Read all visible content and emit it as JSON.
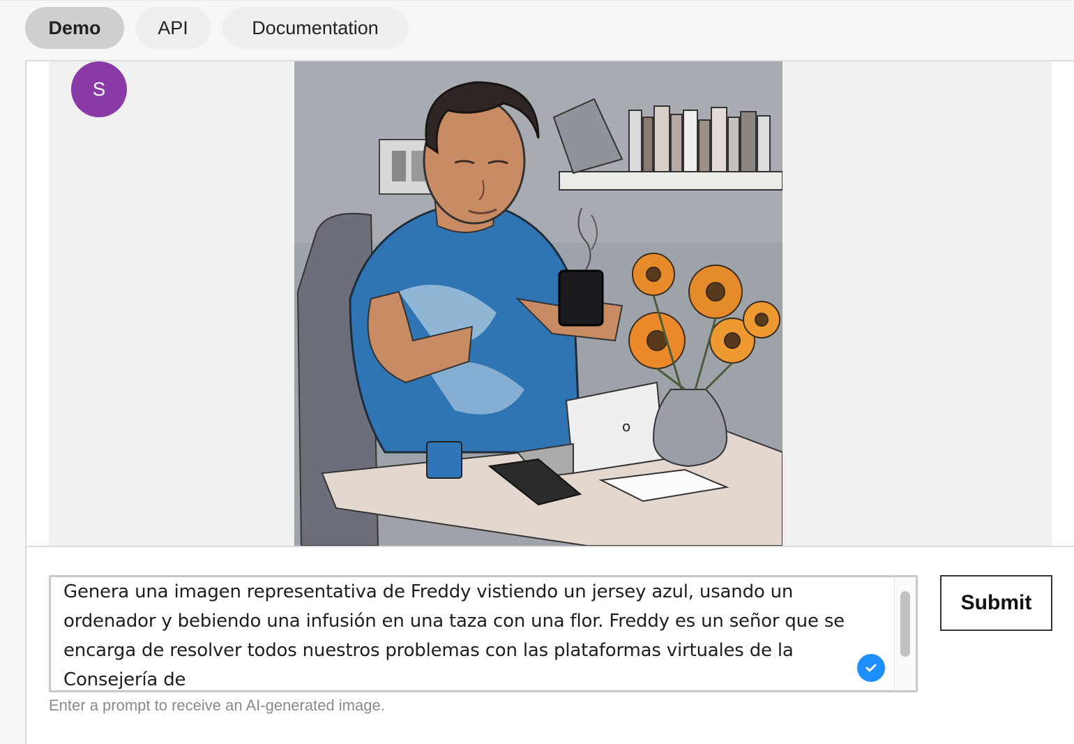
{
  "tabs": [
    {
      "label": "Demo",
      "active": true
    },
    {
      "label": "API",
      "active": false
    },
    {
      "label": "Documentation",
      "active": false
    }
  ],
  "chat": {
    "user_avatar_initial": "S",
    "avatar_color": "#8a3aa6",
    "generated_image_subject": "man in blue t-shirt drinking from mug at laptop with orange flowers in vase"
  },
  "prompt": {
    "value": "Genera una imagen representativa de Freddy vistiendo un jersey azul, usando un ordenador y bebiendo una infusión en una taza con una flor. Freddy es un señor que se encarga de resolver todos nuestros problemas con las plataformas virtuales de la Consejería de",
    "helper_text": "Enter a prompt to receive an AI-generated image."
  },
  "actions": {
    "submit_label": "Submit"
  },
  "colors": {
    "accent_check": "#1e8fff",
    "active_tab": "#cfcfcf"
  }
}
